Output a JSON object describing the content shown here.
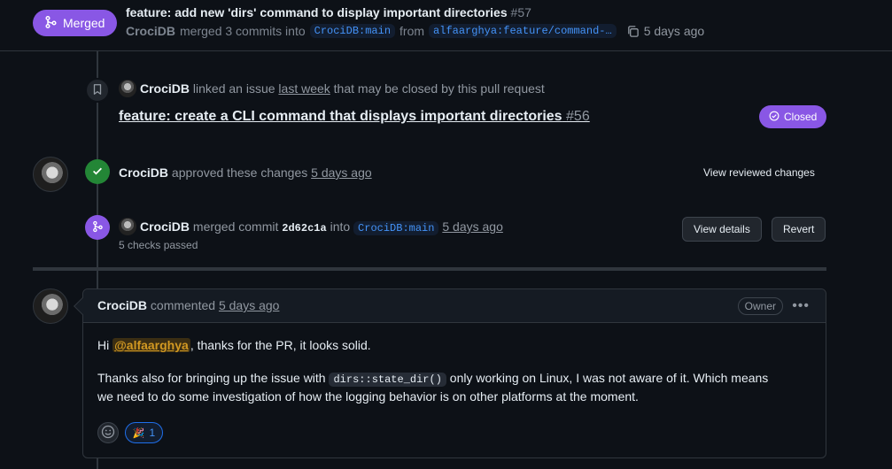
{
  "header": {
    "status_label": "Merged",
    "title": "feature: add new 'dirs' command to display important directories",
    "number": "#57",
    "author": "CrociDB",
    "merged_text": "merged 3 commits into",
    "base_branch": "CrociDB:main",
    "from_text": "from",
    "head_branch": "alfaarghya:feature/command-…",
    "time": "5 days ago"
  },
  "linked_event": {
    "user": "CrociDB",
    "text": "linked an issue",
    "time": "last week",
    "suffix": "that may be closed by this pull request",
    "issue_title": "feature: create a CLI command that displays important directories",
    "issue_number": "#56",
    "issue_status": "Closed"
  },
  "approve_event": {
    "user": "CrociDB",
    "text": "approved these changes",
    "time": "5 days ago",
    "action": "View reviewed changes"
  },
  "merge_event": {
    "user": "CrociDB",
    "text": "merged commit",
    "commit": "2d62c1a",
    "into_text": "into",
    "branch": "CrociDB:main",
    "time": "5 days ago",
    "checks": "5 checks passed",
    "details_label": "View details",
    "revert_label": "Revert"
  },
  "comment": {
    "user": "CrociDB",
    "verb": "commented",
    "time": "5 days ago",
    "role": "Owner",
    "greeting": "Hi",
    "mention": "@alfaarghya",
    "line1_rest": ", thanks for the PR, it looks solid.",
    "line2_a": "Thanks also for bringing up the issue with",
    "code": "dirs::state_dir()",
    "line2_b": "only working on Linux, I was not aware of it. Which means",
    "line3": "we need to do some investigation of how the logging behavior is on other platforms at the moment.",
    "reaction_emoji": "🎉",
    "reaction_count": "1"
  },
  "colors": {
    "merged": "#8957e5",
    "approved": "#238636",
    "link": "#4493f8"
  }
}
